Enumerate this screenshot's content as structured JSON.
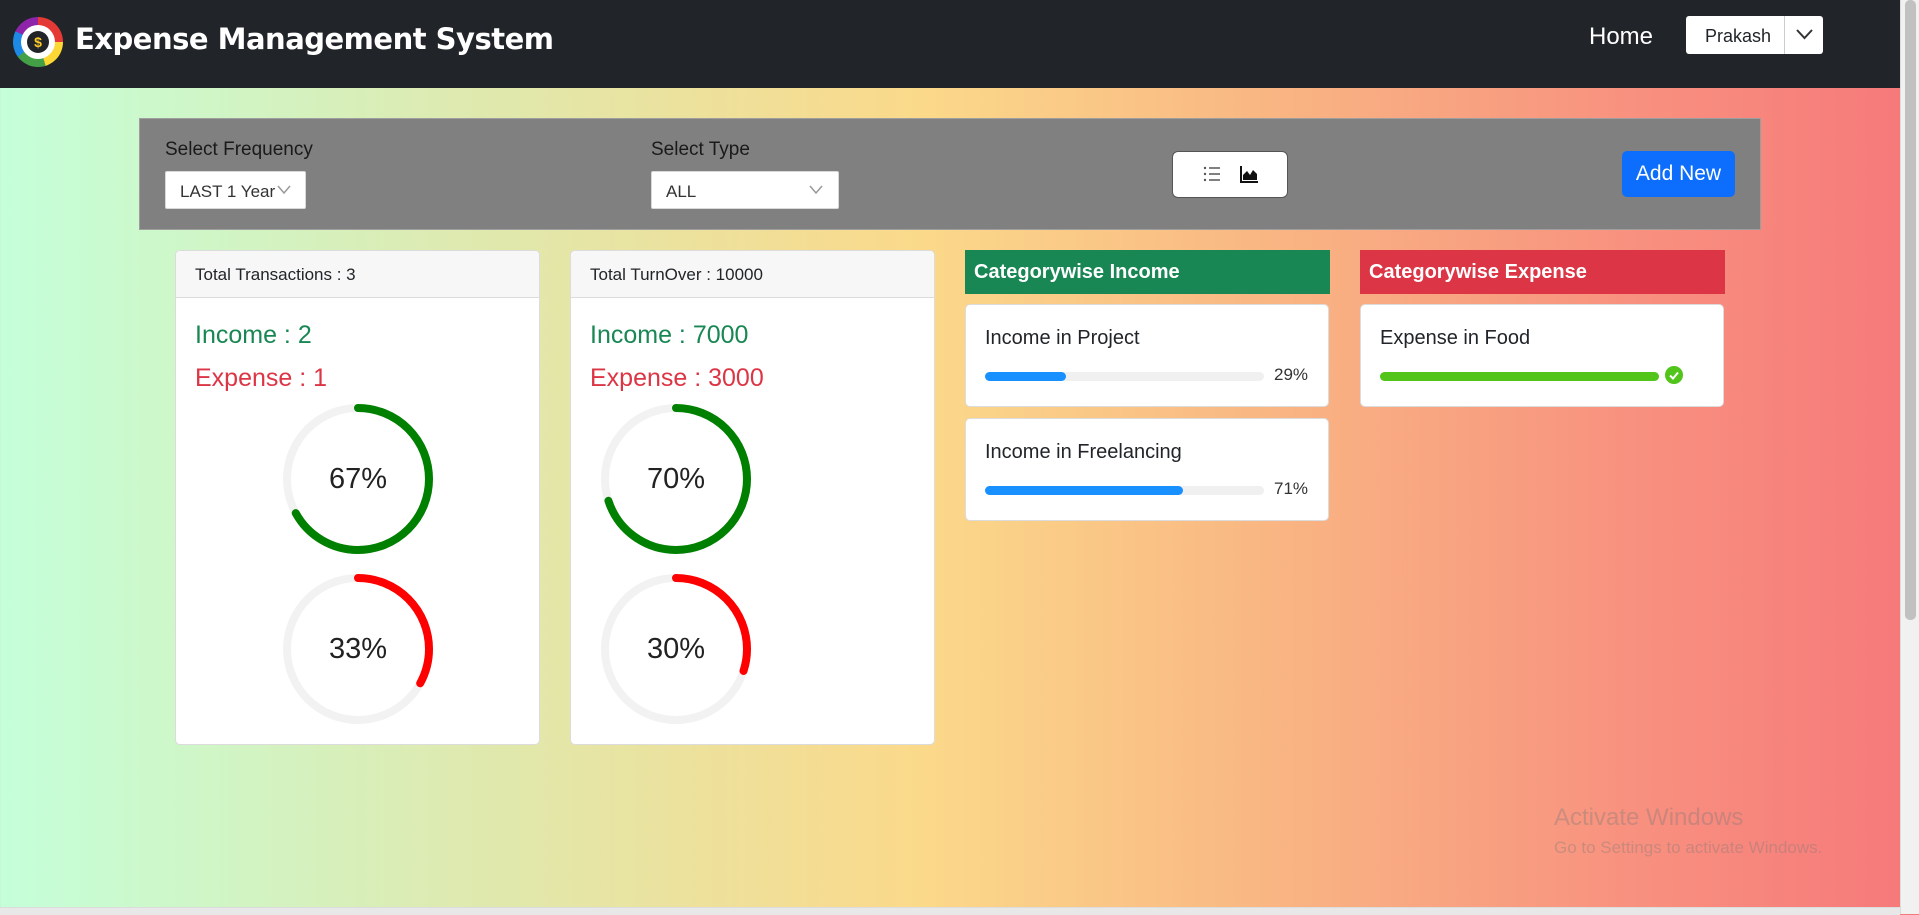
{
  "navbar": {
    "logo_symbol": "$",
    "brand": "Expense Management System",
    "home_link": "Home",
    "user_name": "Prakash"
  },
  "filters": {
    "frequency_label": "Select Frequency",
    "frequency_value": "LAST 1 Year",
    "type_label": "Select Type",
    "type_value": "ALL",
    "view_toggle_icons": [
      "list-icon",
      "area-chart-icon"
    ],
    "add_button": "Add New"
  },
  "transactions_card": {
    "header": "Total Transactions : 3",
    "income_text": "Income : 2",
    "expense_text": "Expense : 1",
    "income_percent": 67,
    "income_percent_label": "67%",
    "expense_percent": 33,
    "expense_percent_label": "33%"
  },
  "turnover_card": {
    "header": "Total TurnOver : 10000",
    "income_text": "Income : 7000",
    "expense_text": "Expense : 3000",
    "income_percent": 70,
    "income_percent_label": "70%",
    "expense_percent": 30,
    "expense_percent_label": "30%"
  },
  "category_income": {
    "title": "Categorywise Income",
    "items": [
      {
        "label": "Income in Project",
        "percent": 29,
        "percent_label": "29%"
      },
      {
        "label": "Income in Freelancing",
        "percent": 71,
        "percent_label": "71%"
      }
    ]
  },
  "category_expense": {
    "title": "Categorywise Expense",
    "items": [
      {
        "label": "Expense in Food",
        "percent": 100
      }
    ]
  },
  "colors": {
    "navbar": "#212529",
    "income_green": "#198754",
    "expense_red": "#dc3545",
    "ring_green": "#008000",
    "ring_red": "#ff0000",
    "progress_blue": "#1890ff",
    "progress_success": "#52c41a",
    "add_button": "#0d6efd"
  },
  "watermark": {
    "line1": "Activate Windows",
    "line2": "Go to Settings to activate Windows."
  }
}
